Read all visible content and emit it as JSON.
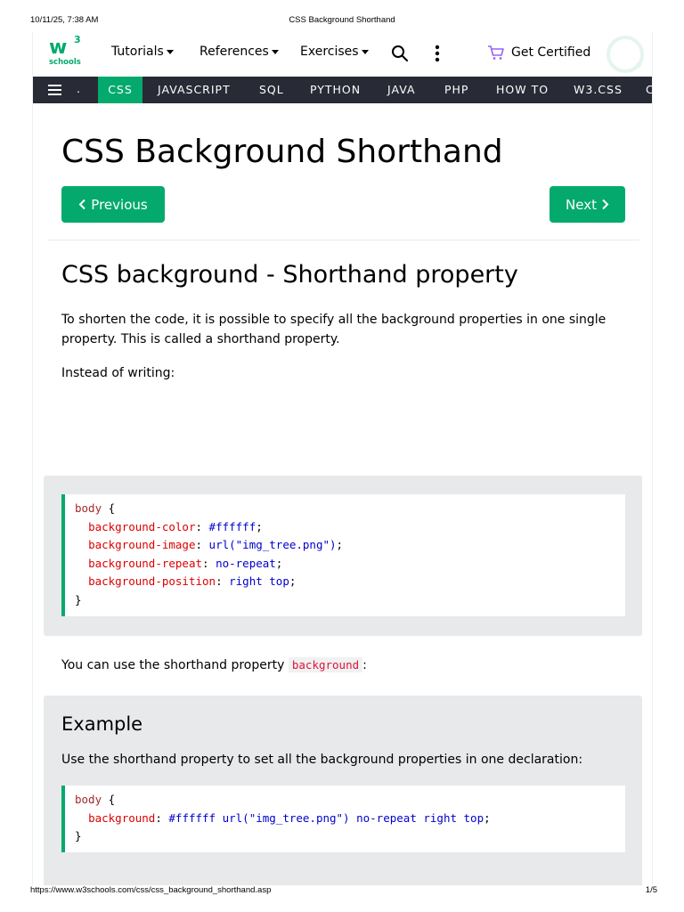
{
  "print": {
    "datetime": "10/11/25, 7:38 AM",
    "doc_title": "CSS Background Shorthand",
    "url": "https://www.w3schools.com/css/css_background_shorthand.asp",
    "page": "1/5"
  },
  "logo": {
    "mark": "w",
    "sup": "3",
    "text": "schools"
  },
  "topnav": {
    "items": [
      {
        "label": "Tutorials"
      },
      {
        "label": "References"
      },
      {
        "label": "Exercises"
      }
    ],
    "get_certified": "Get Certified",
    "icons": [
      "search-icon",
      "more-vertical-icon",
      "cart-icon",
      "spinner-icon"
    ]
  },
  "subnav": {
    "dot": ".",
    "tabs": [
      {
        "label": "CSS",
        "active": true
      },
      {
        "label": "JAVASCRIPT"
      },
      {
        "label": "SQL"
      },
      {
        "label": "PYTHON"
      },
      {
        "label": "JAVA"
      },
      {
        "label": "PHP"
      },
      {
        "label": "HOW TO"
      },
      {
        "label": "W3.CSS"
      },
      {
        "label": "C"
      }
    ]
  },
  "main": {
    "title": "CSS Background Shorthand",
    "prev_label": "Previous",
    "next_label": "Next",
    "section_title": "CSS background - Shorthand property",
    "intro": "To shorten the code, it is possible to specify all the background properties in one single property. This is called a shorthand property.",
    "instead": "Instead of writing:",
    "code1": {
      "selector": "body",
      "open": "{",
      "close": "}",
      "lines": [
        {
          "prop": "background-color",
          "value": "#ffffff"
        },
        {
          "prop": "background-image",
          "value": "url(\"img_tree.png\")"
        },
        {
          "prop": "background-repeat",
          "value": "no-repeat"
        },
        {
          "prop": "background-position",
          "value": "right top"
        }
      ]
    },
    "shorthand_text": "You can use the shorthand property",
    "shorthand_code": "background",
    "shorthand_end": ":",
    "example": {
      "title": "Example",
      "desc": "Use the shorthand property to set all the background properties in one declaration:",
      "code": {
        "selector": "body",
        "open": "{",
        "close": "}",
        "prop": "background",
        "value": "#ffffff url(\"img_tree.png\") no-repeat right top"
      }
    }
  },
  "colors": {
    "brand_green": "#04AA6D",
    "nav_dark": "#282A35",
    "panel_gray": "#E7E9EB",
    "code_selector": "#a52a2a",
    "code_property": "#dd0000",
    "code_value": "#0000cd",
    "inline_code": "#dc143c"
  }
}
